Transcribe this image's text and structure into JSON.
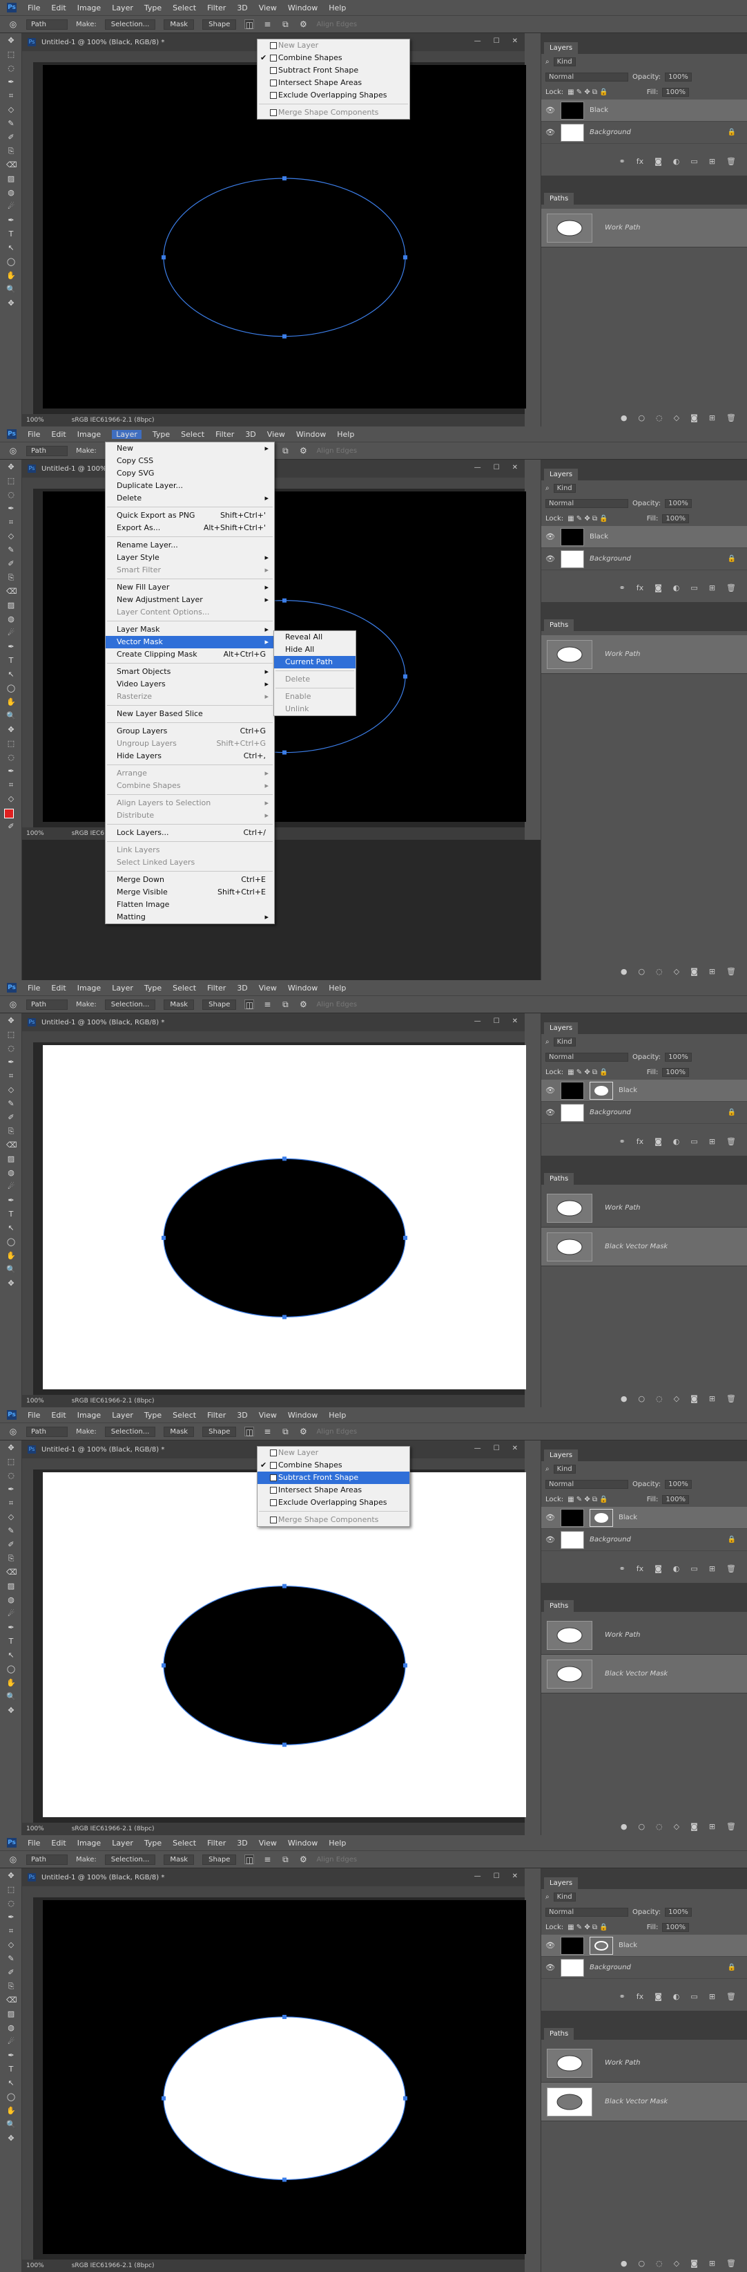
{
  "app": {
    "logo": "Ps",
    "menus": [
      "File",
      "Edit",
      "Image",
      "Layer",
      "Type",
      "Select",
      "Filter",
      "3D",
      "View",
      "Window",
      "Help"
    ]
  },
  "options": {
    "mode": "Path",
    "make_label": "Make:",
    "selection_btn": "Selection...",
    "mask_btn": "Mask",
    "shape_btn": "Shape",
    "align_edges": "Align Edges"
  },
  "document": {
    "tab_title": "Untitled-1 @ 100% (Black, RGB/8) *",
    "zoom": "100%",
    "profile": "sRGB IEC61966-2.1 (8bpc)"
  },
  "layers_panel": {
    "tab": "Layers",
    "kind": "Kind",
    "blend": "Normal",
    "opacity_label": "Opacity:",
    "opacity": "100%",
    "lock_label": "Lock:",
    "fill_label": "Fill:",
    "fill": "100%",
    "layer_black": "Black",
    "layer_background": "Background"
  },
  "paths_panel": {
    "tab": "Paths",
    "work_path": "Work Path",
    "vector_mask": "Black Vector Mask"
  },
  "combine_menu": {
    "items": [
      "New Layer",
      "Combine Shapes",
      "Subtract Front Shape",
      "Intersect Shape Areas",
      "Exclude Overlapping Shapes",
      "Merge Shape Components"
    ]
  },
  "layer_menu": {
    "items": [
      {
        "label": "New",
        "sc": ""
      },
      {
        "label": "Copy CSS",
        "sc": ""
      },
      {
        "label": "Copy SVG",
        "sc": ""
      },
      {
        "label": "Duplicate Layer...",
        "sc": ""
      },
      {
        "label": "Delete",
        "sc": ""
      },
      {
        "label": "Quick Export as PNG",
        "sc": "Shift+Ctrl+'"
      },
      {
        "label": "Export As...",
        "sc": "Alt+Shift+Ctrl+'"
      },
      {
        "label": "Rename Layer...",
        "sc": ""
      },
      {
        "label": "Layer Style",
        "sc": ""
      },
      {
        "label": "Smart Filter",
        "sc": ""
      },
      {
        "label": "New Fill Layer",
        "sc": ""
      },
      {
        "label": "New Adjustment Layer",
        "sc": ""
      },
      {
        "label": "Layer Content Options...",
        "sc": ""
      },
      {
        "label": "Layer Mask",
        "sc": ""
      },
      {
        "label": "Vector Mask",
        "sc": ""
      },
      {
        "label": "Create Clipping Mask",
        "sc": "Alt+Ctrl+G"
      },
      {
        "label": "Smart Objects",
        "sc": ""
      },
      {
        "label": "Video Layers",
        "sc": ""
      },
      {
        "label": "Rasterize",
        "sc": ""
      },
      {
        "label": "New Layer Based Slice",
        "sc": ""
      },
      {
        "label": "Group Layers",
        "sc": "Ctrl+G"
      },
      {
        "label": "Ungroup Layers",
        "sc": "Shift+Ctrl+G"
      },
      {
        "label": "Hide Layers",
        "sc": "Ctrl+,"
      },
      {
        "label": "Arrange",
        "sc": ""
      },
      {
        "label": "Combine Shapes",
        "sc": ""
      },
      {
        "label": "Align Layers to Selection",
        "sc": ""
      },
      {
        "label": "Distribute",
        "sc": ""
      },
      {
        "label": "Lock Layers...",
        "sc": "Ctrl+/"
      },
      {
        "label": "Link Layers",
        "sc": ""
      },
      {
        "label": "Select Linked Layers",
        "sc": ""
      },
      {
        "label": "Merge Down",
        "sc": "Ctrl+E"
      },
      {
        "label": "Merge Visible",
        "sc": "Shift+Ctrl+E"
      },
      {
        "label": "Flatten Image",
        "sc": ""
      },
      {
        "label": "Matting",
        "sc": ""
      }
    ]
  },
  "vector_submenu": {
    "items": [
      "Reveal All",
      "Hide All",
      "Current Path",
      "Delete",
      "Enable",
      "Unlink"
    ]
  },
  "colors": {
    "accent": "#2f6fd8",
    "path_blue": "#3c7ee8",
    "fg_swatch": "#e02020"
  }
}
